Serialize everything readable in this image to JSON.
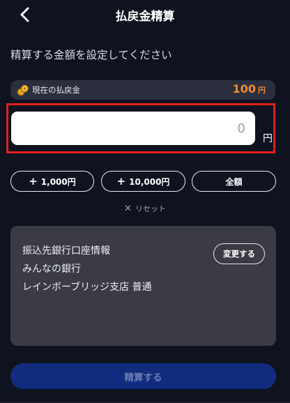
{
  "header": {
    "title": "払戻金精算",
    "back_icon": "chevron-left-icon"
  },
  "instruction": "精算する金額を設定してください",
  "balance": {
    "label": "現在の払戻金",
    "value": "100",
    "unit": "円",
    "icon": "coins-icon",
    "value_color": "#f08a2e"
  },
  "amount_input": {
    "placeholder": "0",
    "value": "",
    "unit": "円"
  },
  "quick_buttons": [
    {
      "label": "1,000円",
      "prefix": "+"
    },
    {
      "label": "10,000円",
      "prefix": "+"
    },
    {
      "label": "全額",
      "prefix": ""
    }
  ],
  "reset": {
    "label": "リセット",
    "icon": "close-icon"
  },
  "bank": {
    "heading": "振込先銀行口座情報",
    "bank_name": "みんなの銀行",
    "branch": "レインボーブリッジ支店 普通",
    "change_label": "変更する"
  },
  "submit": {
    "label": "精算する"
  },
  "colors": {
    "background": "#0f1320",
    "accent": "#f08a2e",
    "highlight": "#e0201f",
    "submit_bg": "#112c7e"
  }
}
